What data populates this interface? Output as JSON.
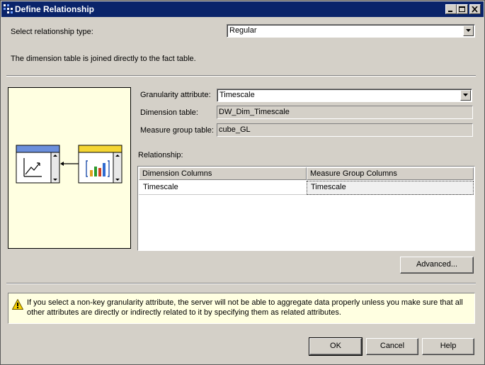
{
  "window": {
    "title": "Define Relationship"
  },
  "relationship_type": {
    "label": "Select relationship type:",
    "value": "Regular"
  },
  "description": "The dimension table is joined directly to the fact table.",
  "fields": {
    "granularity": {
      "label": "Granularity attribute:",
      "value": "Timescale"
    },
    "dimension_table": {
      "label": "Dimension table:",
      "value": "DW_Dim_Timescale"
    },
    "measure_group_table": {
      "label": "Measure group table:",
      "value": "cube_GL"
    }
  },
  "relationship": {
    "label": "Relationship:",
    "columns": [
      "Dimension Columns",
      "Measure Group Columns"
    ],
    "rows": [
      [
        "Timescale",
        "Timescale"
      ]
    ]
  },
  "buttons": {
    "advanced": "Advanced...",
    "ok": "OK",
    "cancel": "Cancel",
    "help": "Help"
  },
  "warning": "If you select a non-key granularity attribute, the server will not be able to aggregate data properly unless you make sure that all other attributes are directly or indirectly related to it by specifying them as related attributes.",
  "icons": {
    "app": "relationship-icon",
    "warning": "warning-icon",
    "minimize": "minimize-icon",
    "maximize": "maximize-icon",
    "close": "close-icon"
  },
  "colors": {
    "titlebar": "#0a246a",
    "diagram_bg": "#ffffe1",
    "dimension_header": "#6b8fdc",
    "fact_header": "#f5d633"
  }
}
